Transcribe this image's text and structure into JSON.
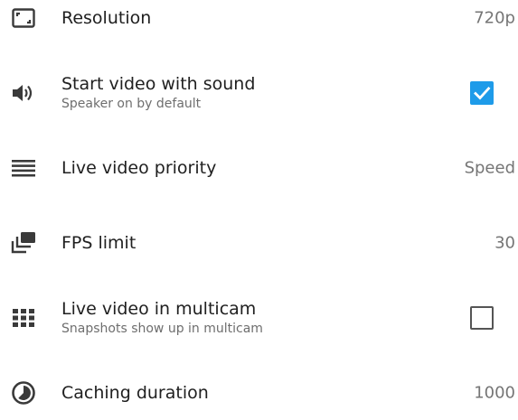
{
  "settings": [
    {
      "title": "Resolution",
      "value": "720p",
      "icon": "resolution-icon"
    },
    {
      "title": "Start video with sound",
      "subtitle": "Speaker on by default",
      "checked": true,
      "icon": "speaker-icon"
    },
    {
      "title": "Live video priority",
      "value": "Speed",
      "icon": "priority-icon"
    },
    {
      "title": "FPS limit",
      "value": "30",
      "icon": "fps-icon"
    },
    {
      "title": "Live video in multicam",
      "subtitle": "Snapshots show up in multicam",
      "checked": false,
      "icon": "grid-icon"
    },
    {
      "title": "Caching duration",
      "value": "1000",
      "icon": "clock-icon"
    }
  ],
  "colors": {
    "accent": "#1e9be9",
    "icon": "#3a3a3a"
  }
}
